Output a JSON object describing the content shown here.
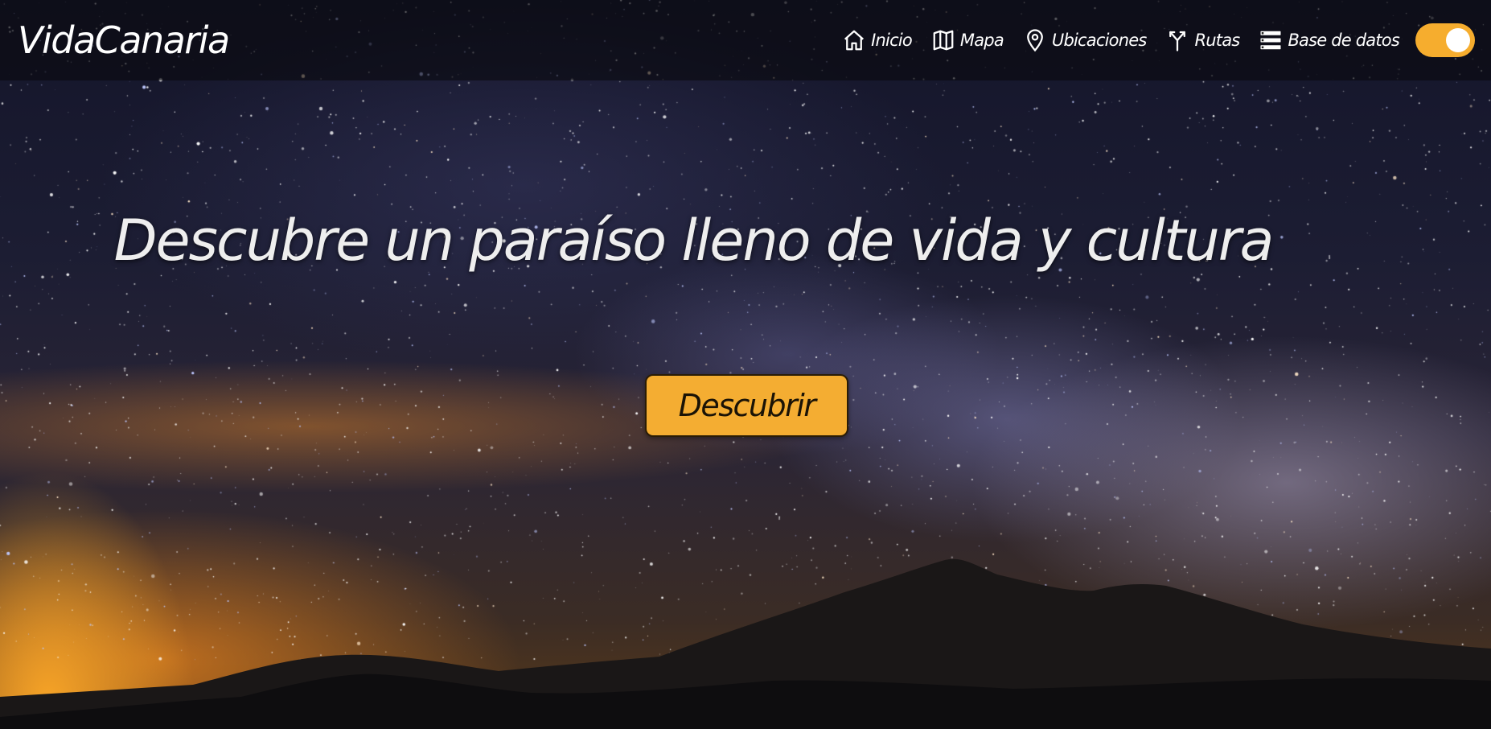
{
  "brand": {
    "name": "VidaCanaria"
  },
  "nav": {
    "items": [
      {
        "label": "Inicio",
        "icon": "home-icon"
      },
      {
        "label": "Mapa",
        "icon": "map-icon"
      },
      {
        "label": "Ubicaciones",
        "icon": "location-pin-icon"
      },
      {
        "label": "Rutas",
        "icon": "fork-route-icon"
      },
      {
        "label": "Base de datos",
        "icon": "database-list-icon"
      }
    ],
    "theme_toggle": {
      "state": "on",
      "color": "#f6ad2e"
    }
  },
  "hero": {
    "headline": "Descubre un paraíso lleno de vida y cultura",
    "cta_label": "Descubrir",
    "cta_color": "#f4ad32",
    "background": "night sky with milky way over mountain silhouette"
  }
}
